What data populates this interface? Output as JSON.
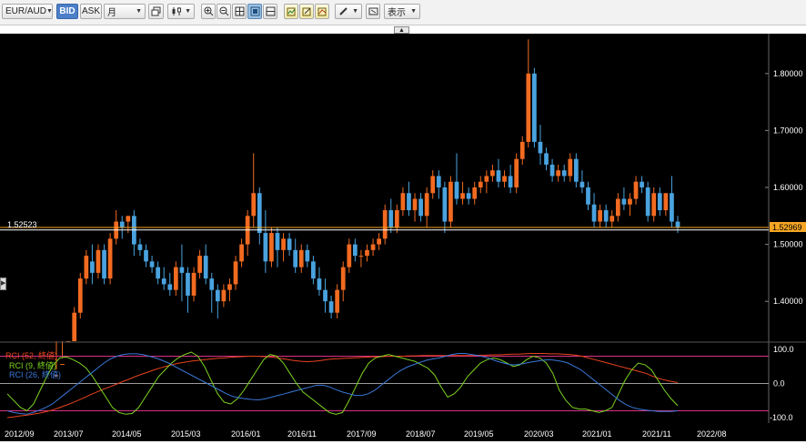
{
  "toolbar": {
    "symbol": "EUR/AUD",
    "bid_label": "BID",
    "ask_label": "ASK",
    "timeframe": "月",
    "display_label": "表示"
  },
  "price_axis": {
    "ticks": [
      "1.80000",
      "1.70000",
      "1.60000",
      "1.50000",
      "1.40000"
    ],
    "current_price": "1.52969",
    "crosshair_value": "1.52523"
  },
  "indicator": {
    "legend": [
      "RCI (52, 終値)",
      "RCI (9, 終値)",
      "RCI (26, 終値)"
    ],
    "ticks": [
      "100.0",
      "0.0",
      "-100.0"
    ]
  },
  "time_axis": {
    "labels": [
      "2012/09",
      "2013/07",
      "2014/05",
      "2015/03",
      "2016/01",
      "2016/11",
      "2017/09",
      "2018/07",
      "2019/05",
      "2020/03",
      "2021/01",
      "2021/11",
      "2022/08"
    ]
  },
  "colors": {
    "background": "#000000",
    "bull": "#f26b21",
    "bear": "#4aa3df",
    "price_line": "#f5a623",
    "rci52": "#e8431e",
    "rci9": "#7ed321",
    "rci26": "#3a78d8",
    "band": "#d63384"
  },
  "chart_data": [
    {
      "type": "candlestick",
      "title": "EUR/AUD",
      "timeframe": "monthly",
      "ylim": [
        1.33,
        1.87
      ],
      "candles": [
        [
          1.25,
          1.28,
          1.24,
          1.27
        ],
        [
          1.27,
          1.3,
          1.26,
          1.29
        ],
        [
          1.3,
          1.33,
          1.29,
          1.33
        ],
        [
          1.33,
          1.39,
          1.3,
          1.38
        ],
        [
          1.38,
          1.45,
          1.37,
          1.44
        ],
        [
          1.44,
          1.49,
          1.43,
          1.48
        ],
        [
          1.47,
          1.5,
          1.43,
          1.45
        ],
        [
          1.45,
          1.5,
          1.44,
          1.49
        ],
        [
          1.49,
          1.5,
          1.43,
          1.44
        ],
        [
          1.44,
          1.52,
          1.43,
          1.51
        ],
        [
          1.51,
          1.56,
          1.5,
          1.54
        ],
        [
          1.54,
          1.55,
          1.51,
          1.53
        ],
        [
          1.54,
          1.55,
          1.52,
          1.55
        ],
        [
          1.55,
          1.56,
          1.48,
          1.5
        ],
        [
          1.5,
          1.51,
          1.48,
          1.49
        ],
        [
          1.49,
          1.5,
          1.46,
          1.47
        ],
        [
          1.47,
          1.48,
          1.45,
          1.46
        ],
        [
          1.46,
          1.47,
          1.43,
          1.44
        ],
        [
          1.44,
          1.46,
          1.42,
          1.43
        ],
        [
          1.43,
          1.45,
          1.41,
          1.42
        ],
        [
          1.42,
          1.47,
          1.41,
          1.46
        ],
        [
          1.46,
          1.5,
          1.4,
          1.45
        ],
        [
          1.45,
          1.46,
          1.38,
          1.41
        ],
        [
          1.41,
          1.46,
          1.4,
          1.45
        ],
        [
          1.45,
          1.49,
          1.44,
          1.48
        ],
        [
          1.48,
          1.5,
          1.43,
          1.44
        ],
        [
          1.44,
          1.45,
          1.38,
          1.42
        ],
        [
          1.42,
          1.43,
          1.37,
          1.4
        ],
        [
          1.4,
          1.43,
          1.39,
          1.42
        ],
        [
          1.42,
          1.44,
          1.4,
          1.43
        ],
        [
          1.43,
          1.48,
          1.42,
          1.47
        ],
        [
          1.47,
          1.51,
          1.46,
          1.5
        ],
        [
          1.5,
          1.56,
          1.48,
          1.55
        ],
        [
          1.55,
          1.66,
          1.53,
          1.59
        ],
        [
          1.59,
          1.6,
          1.5,
          1.52
        ],
        [
          1.52,
          1.56,
          1.45,
          1.47
        ],
        [
          1.47,
          1.53,
          1.46,
          1.52
        ],
        [
          1.52,
          1.53,
          1.46,
          1.49
        ],
        [
          1.49,
          1.52,
          1.47,
          1.51
        ],
        [
          1.51,
          1.52,
          1.48,
          1.49
        ],
        [
          1.49,
          1.51,
          1.45,
          1.46
        ],
        [
          1.46,
          1.5,
          1.45,
          1.49
        ],
        [
          1.49,
          1.5,
          1.46,
          1.47
        ],
        [
          1.47,
          1.48,
          1.43,
          1.44
        ],
        [
          1.44,
          1.46,
          1.41,
          1.42
        ],
        [
          1.42,
          1.44,
          1.38,
          1.4
        ],
        [
          1.4,
          1.41,
          1.37,
          1.38
        ],
        [
          1.38,
          1.43,
          1.37,
          1.42
        ],
        [
          1.42,
          1.47,
          1.4,
          1.46
        ],
        [
          1.46,
          1.51,
          1.45,
          1.5
        ],
        [
          1.5,
          1.51,
          1.47,
          1.48
        ],
        [
          1.48,
          1.49,
          1.46,
          1.48
        ],
        [
          1.48,
          1.5,
          1.47,
          1.49
        ],
        [
          1.49,
          1.51,
          1.48,
          1.5
        ],
        [
          1.5,
          1.52,
          1.49,
          1.51
        ],
        [
          1.51,
          1.57,
          1.5,
          1.56
        ],
        [
          1.56,
          1.58,
          1.52,
          1.53
        ],
        [
          1.53,
          1.57,
          1.52,
          1.56
        ],
        [
          1.56,
          1.6,
          1.55,
          1.59
        ],
        [
          1.59,
          1.61,
          1.55,
          1.56
        ],
        [
          1.56,
          1.59,
          1.54,
          1.58
        ],
        [
          1.58,
          1.59,
          1.54,
          1.55
        ],
        [
          1.55,
          1.6,
          1.53,
          1.59
        ],
        [
          1.59,
          1.63,
          1.58,
          1.62
        ],
        [
          1.62,
          1.63,
          1.58,
          1.6
        ],
        [
          1.6,
          1.61,
          1.52,
          1.54
        ],
        [
          1.54,
          1.62,
          1.53,
          1.61
        ],
        [
          1.61,
          1.66,
          1.57,
          1.58
        ],
        [
          1.58,
          1.61,
          1.57,
          1.59
        ],
        [
          1.59,
          1.6,
          1.57,
          1.58
        ],
        [
          1.58,
          1.61,
          1.57,
          1.6
        ],
        [
          1.6,
          1.62,
          1.59,
          1.61
        ],
        [
          1.61,
          1.63,
          1.59,
          1.62
        ],
        [
          1.62,
          1.64,
          1.61,
          1.63
        ],
        [
          1.63,
          1.65,
          1.6,
          1.61
        ],
        [
          1.61,
          1.63,
          1.6,
          1.62
        ],
        [
          1.62,
          1.64,
          1.59,
          1.6
        ],
        [
          1.6,
          1.66,
          1.59,
          1.65
        ],
        [
          1.65,
          1.69,
          1.64,
          1.68
        ],
        [
          1.68,
          1.86,
          1.67,
          1.8
        ],
        [
          1.8,
          1.81,
          1.67,
          1.68
        ],
        [
          1.68,
          1.71,
          1.64,
          1.66
        ],
        [
          1.66,
          1.67,
          1.63,
          1.64
        ],
        [
          1.64,
          1.65,
          1.61,
          1.62
        ],
        [
          1.62,
          1.64,
          1.61,
          1.63
        ],
        [
          1.63,
          1.64,
          1.61,
          1.62
        ],
        [
          1.62,
          1.66,
          1.61,
          1.65
        ],
        [
          1.65,
          1.66,
          1.6,
          1.61
        ],
        [
          1.61,
          1.63,
          1.59,
          1.6
        ],
        [
          1.6,
          1.61,
          1.56,
          1.57
        ],
        [
          1.57,
          1.59,
          1.53,
          1.54
        ],
        [
          1.54,
          1.57,
          1.53,
          1.56
        ],
        [
          1.56,
          1.57,
          1.53,
          1.54
        ],
        [
          1.54,
          1.56,
          1.53,
          1.55
        ],
        [
          1.55,
          1.59,
          1.54,
          1.58
        ],
        [
          1.58,
          1.6,
          1.56,
          1.57
        ],
        [
          1.57,
          1.59,
          1.55,
          1.58
        ],
        [
          1.58,
          1.62,
          1.57,
          1.61
        ],
        [
          1.61,
          1.62,
          1.59,
          1.6
        ],
        [
          1.6,
          1.61,
          1.54,
          1.55
        ],
        [
          1.55,
          1.6,
          1.54,
          1.59
        ],
        [
          1.59,
          1.6,
          1.55,
          1.56
        ],
        [
          1.56,
          1.59,
          1.55,
          1.59
        ],
        [
          1.59,
          1.62,
          1.53,
          1.54
        ],
        [
          1.54,
          1.55,
          1.52,
          1.53
        ]
      ],
      "current_price": 1.52969,
      "crosshair_price": 1.52523,
      "ylabel_ticks": [
        1.8,
        1.7,
        1.6,
        1.5,
        1.4
      ]
    },
    {
      "type": "line",
      "title": "RCI",
      "ylim": [
        -100,
        100
      ],
      "bands": [
        80,
        0,
        -80
      ],
      "series": [
        {
          "name": "RCI (52, 終値)",
          "values": [
            -100,
            -98,
            -95,
            -93,
            -90,
            -87,
            -83,
            -78,
            -72,
            -65,
            -58,
            -50,
            -42,
            -33,
            -25,
            -17,
            -10,
            -3,
            5,
            12,
            20,
            27,
            33,
            40,
            46,
            51,
            56,
            60,
            63,
            66,
            68,
            70,
            72,
            74,
            75,
            77,
            78,
            79,
            80,
            80,
            79,
            78,
            76,
            73,
            70,
            67,
            65,
            64,
            65,
            67,
            70,
            72,
            73,
            74,
            75,
            76,
            77,
            78,
            78,
            79,
            80,
            80,
            80,
            81,
            81,
            82,
            82,
            82,
            82,
            82,
            82,
            82,
            82,
            82,
            83,
            83,
            84,
            84,
            85,
            86,
            86,
            87,
            88,
            88,
            88,
            87,
            87,
            86,
            85,
            83,
            80,
            75,
            70,
            65,
            60,
            55,
            50,
            45,
            40,
            35,
            30,
            22,
            15,
            10,
            6,
            3
          ]
        },
        {
          "name": "RCI (9, 終値)",
          "values": [
            -30,
            -50,
            -70,
            -80,
            -60,
            -20,
            20,
            55,
            75,
            78,
            70,
            60,
            45,
            20,
            -10,
            -40,
            -70,
            -85,
            -90,
            -88,
            -70,
            -40,
            -10,
            20,
            40,
            60,
            75,
            85,
            92,
            80,
            50,
            10,
            -30,
            -55,
            -60,
            -45,
            -20,
            10,
            40,
            70,
            85,
            80,
            60,
            30,
            0,
            -25,
            -40,
            -55,
            -70,
            -85,
            -90,
            -85,
            -50,
            -10,
            30,
            60,
            75,
            80,
            85,
            80,
            75,
            70,
            65,
            55,
            45,
            25,
            -10,
            -40,
            -30,
            -10,
            20,
            40,
            60,
            70,
            75,
            70,
            60,
            50,
            55,
            70,
            80,
            75,
            60,
            30,
            -20,
            -50,
            -70,
            -75,
            -75,
            -80,
            -85,
            -80,
            -70,
            -30,
            10,
            40,
            60,
            55,
            40,
            10,
            -20,
            -45,
            -65
          ]
        },
        {
          "name": "RCI (26, 終値)",
          "values": [
            -80,
            -85,
            -88,
            -90,
            -85,
            -78,
            -70,
            -60,
            -45,
            -30,
            -15,
            0,
            15,
            30,
            45,
            60,
            72,
            80,
            85,
            87,
            87,
            85,
            80,
            75,
            68,
            60,
            50,
            40,
            30,
            20,
            10,
            0,
            -10,
            -20,
            -30,
            -38,
            -42,
            -45,
            -47,
            -48,
            -45,
            -40,
            -35,
            -30,
            -25,
            -20,
            -15,
            -10,
            -5,
            -5,
            -10,
            -18,
            -25,
            -30,
            -35,
            -35,
            -30,
            -20,
            -5,
            10,
            25,
            38,
            48,
            55,
            62,
            68,
            72,
            75,
            80,
            85,
            88,
            88,
            85,
            82,
            78,
            72,
            65,
            60,
            55,
            55,
            58,
            62,
            65,
            68,
            70,
            68,
            65,
            60,
            50,
            40,
            25,
            10,
            -5,
            -20,
            -35,
            -50,
            -62,
            -70,
            -75,
            -78,
            -80,
            -82,
            -82,
            -82,
            -80
          ]
        }
      ]
    }
  ]
}
